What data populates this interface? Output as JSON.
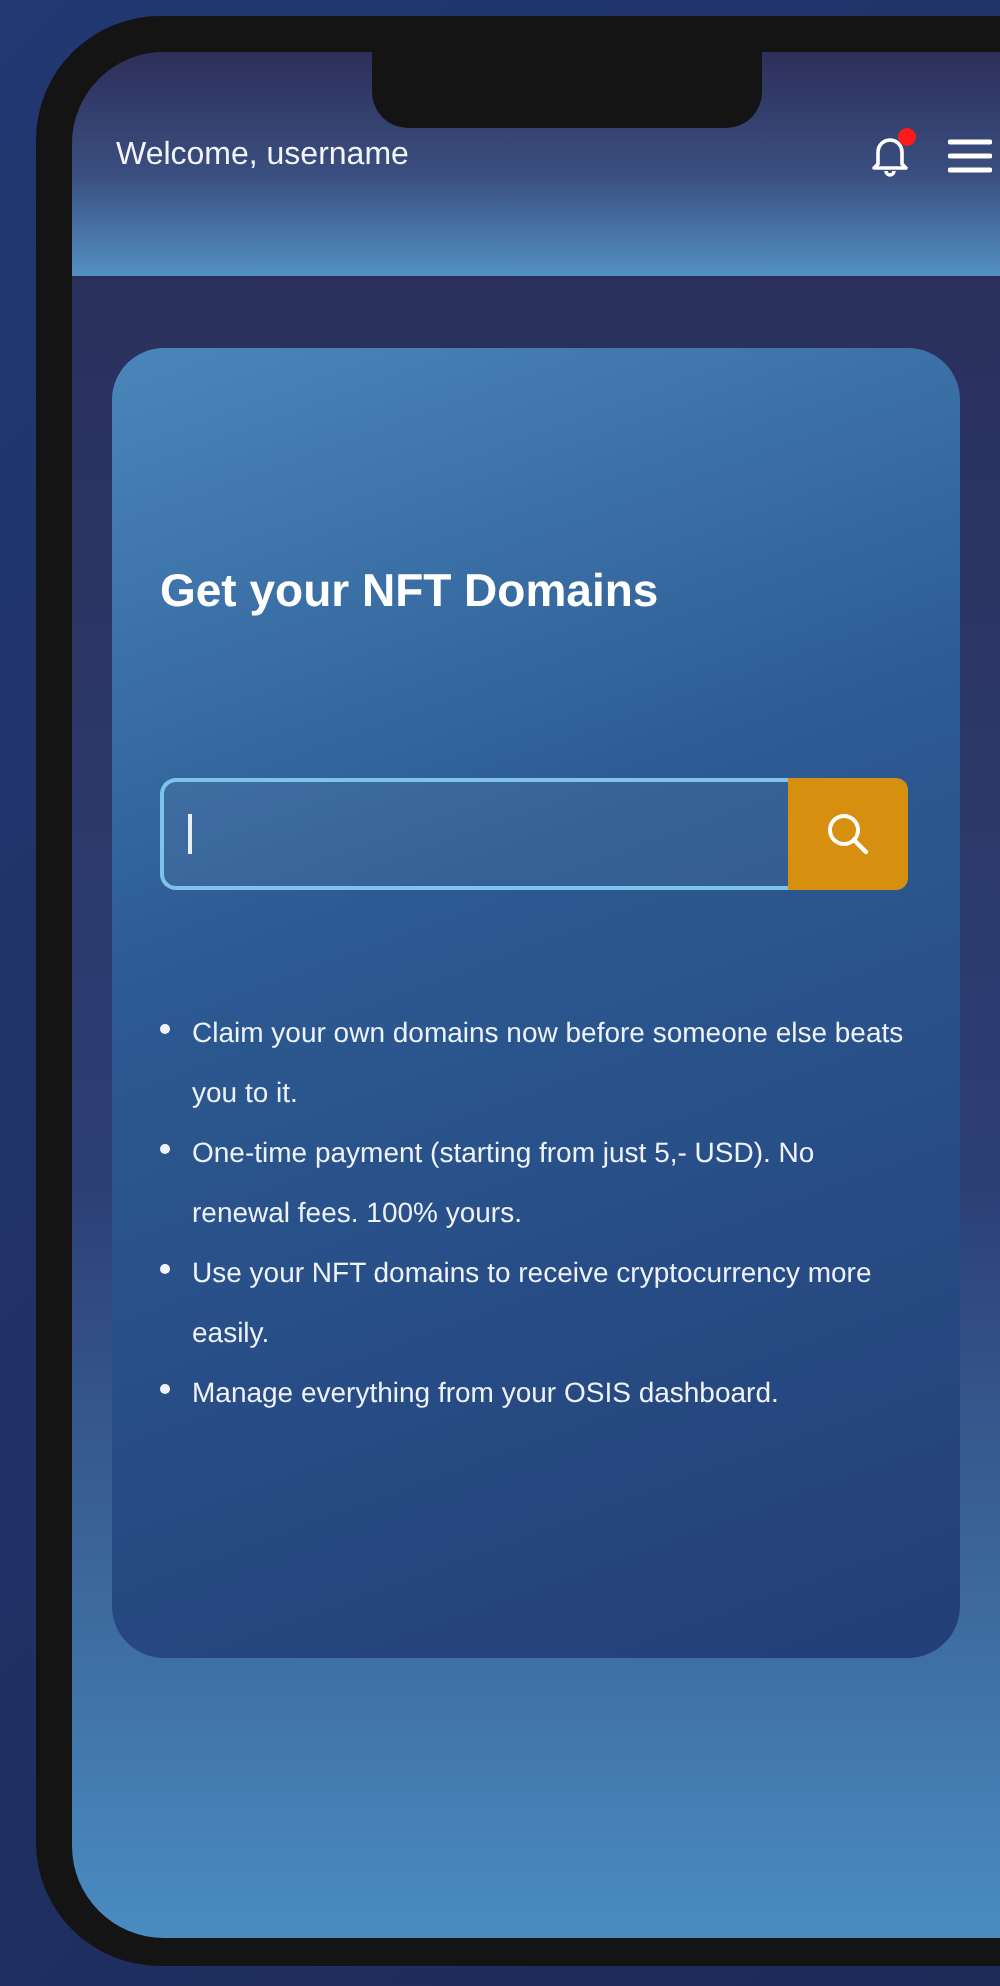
{
  "header": {
    "greeting": "Welcome, username",
    "has_notification": true
  },
  "card": {
    "title": "Get your NFT Domains",
    "bullets": [
      "Claim your own domains now before someone else beats you to it.",
      "One-time payment (starting from just 5,- USD). No renewal fees. 100% yours.",
      "Use your NFT domains to receive cryptocurrency more easily.",
      "Manage everything from your OSIS dashboard."
    ]
  }
}
